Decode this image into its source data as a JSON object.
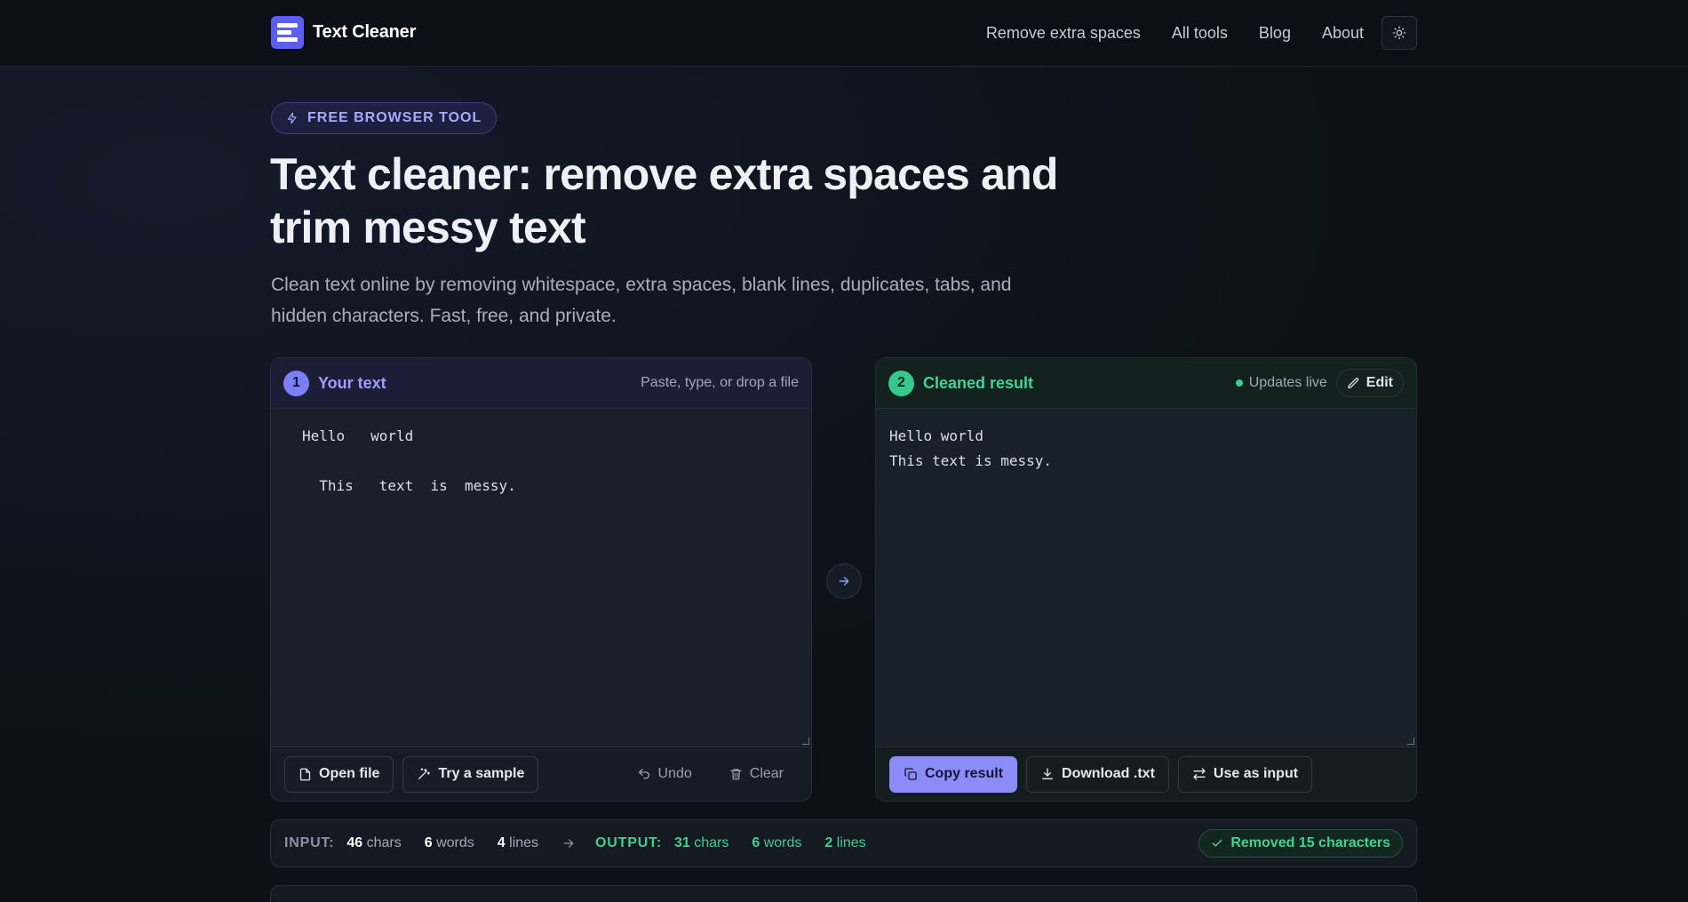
{
  "header": {
    "brand": "Text Cleaner",
    "nav": [
      "Remove extra spaces",
      "All tools",
      "Blog",
      "About"
    ]
  },
  "hero": {
    "badge": "FREE BROWSER TOOL",
    "title": "Text cleaner: remove extra spaces and trim messy text",
    "subtitle": "Clean text online by removing whitespace, extra spaces, blank lines, duplicates, tabs, and hidden characters. Fast, free, and private."
  },
  "input_panel": {
    "step": "1",
    "title": "Your text",
    "hint": "Paste, type, or drop a file",
    "text": "Hello   world\n\n  This   text  is  messy.",
    "buttons": {
      "open_file": "Open file",
      "sample": "Try a sample",
      "undo": "Undo",
      "clear": "Clear"
    }
  },
  "output_panel": {
    "step": "2",
    "title": "Cleaned result",
    "status": "Updates live",
    "edit": "Edit",
    "text": "Hello world\nThis text is messy.",
    "buttons": {
      "copy": "Copy result",
      "download": "Download .txt",
      "use_as_input": "Use as input"
    }
  },
  "stats": {
    "input_label": "INPUT:",
    "output_label": "OUTPUT:",
    "input": {
      "chars": "46",
      "words": "6",
      "lines": "4"
    },
    "output": {
      "chars": "31",
      "words": "6",
      "lines": "2"
    },
    "unit_chars": "chars",
    "unit_words": "words",
    "unit_lines": "lines",
    "removed": "Removed 15 characters"
  },
  "colors": {
    "accent": "#8b8cf8",
    "success": "#3ecf8e",
    "background": "#0d1117"
  }
}
